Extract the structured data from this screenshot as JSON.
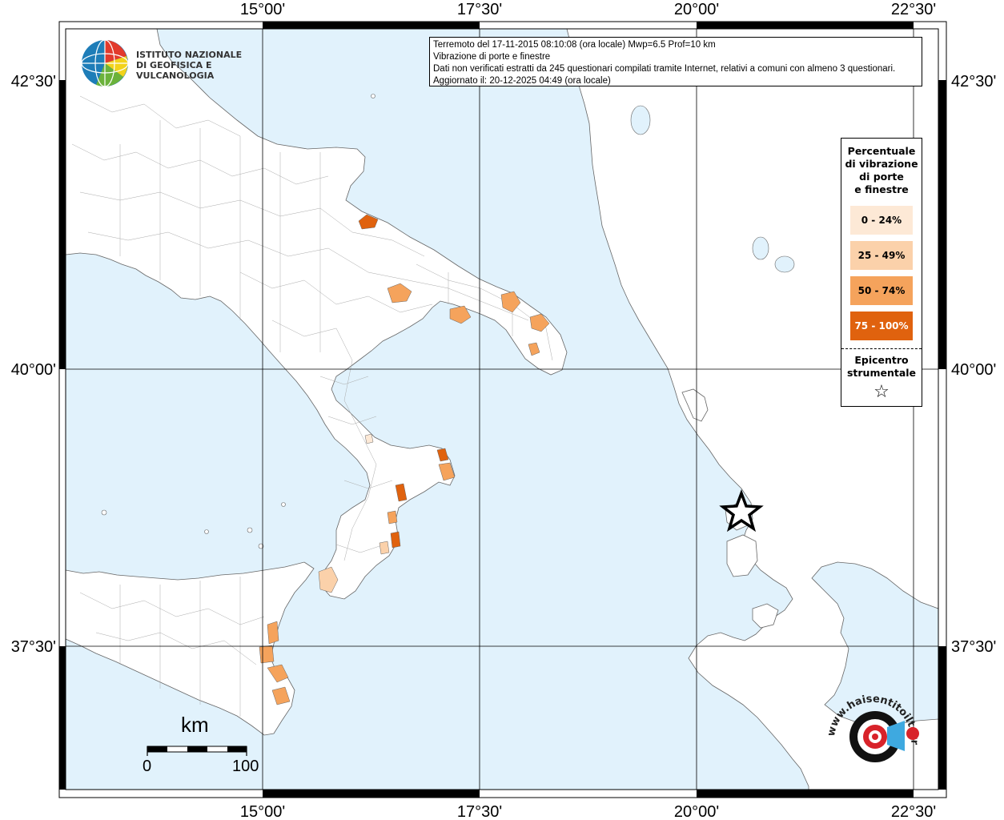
{
  "header": {
    "line1": "Terremoto del 17-11-2015 08:10:08 (ora locale) Mwp=6.5 Prof=10 km",
    "line2": "Vibrazione di porte e finestre",
    "line3": "Dati non verificati estratti da 245 questionari compilati tramite Internet, relativi a comuni con almeno 3 questionari.",
    "line4": "Aggiornato il: 20-12-2025 04:49 (ora locale)"
  },
  "logo": {
    "line1": "ISTITUTO NAZIONALE",
    "line2": "DI GEOFISICA E VULCANOLOGIA"
  },
  "axes": {
    "lon_labels": [
      "15°00'",
      "17°30'",
      "20°00'",
      "22°30'"
    ],
    "lat_labels": [
      "42°30'",
      "40°00'",
      "37°30'"
    ]
  },
  "legend": {
    "title_lines": [
      "Percentuale",
      "di vibrazione",
      "di porte",
      "e finestre"
    ],
    "items": [
      {
        "label": "0 - 24%",
        "color": "#fde9d6",
        "text_color": "#000000"
      },
      {
        "label": "25 - 49%",
        "color": "#fbd1aa",
        "text_color": "#000000"
      },
      {
        "label": "50 - 74%",
        "color": "#f5a35c",
        "text_color": "#000000"
      },
      {
        "label": "75 - 100%",
        "color": "#e0620e",
        "text_color": "#ffffff"
      }
    ],
    "epicenter_lines": [
      "Epicentro",
      "strumentale"
    ],
    "epicenter_symbol": "☆"
  },
  "scale": {
    "unit": "km",
    "min": "0",
    "max": "100"
  },
  "watermark": {
    "text": "www.haisentitoilterremoto.it"
  },
  "colors": {
    "sea": "#e1f2fc",
    "land": "#ffffff",
    "boundary": "#999999",
    "grid": "#000000"
  }
}
